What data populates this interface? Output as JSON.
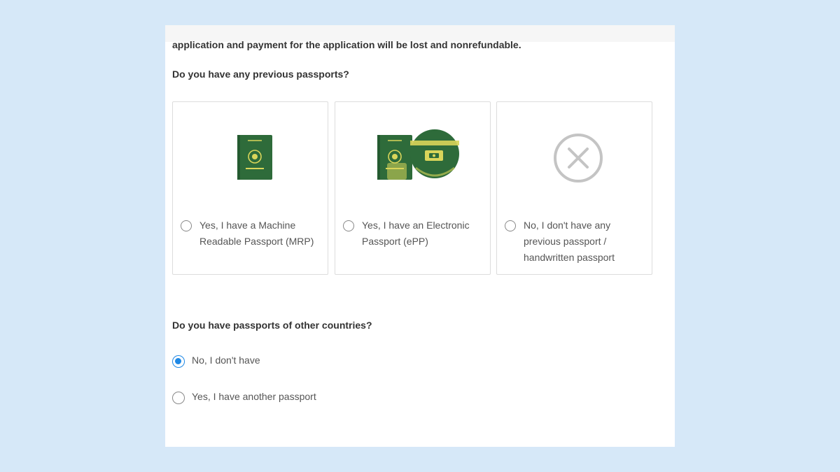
{
  "intro": {
    "text": "application and payment for the application will be lost and nonrefundable."
  },
  "previous_passports": {
    "question": "Do you have any previous passports?",
    "options": [
      {
        "label": "Yes, I have a Machine Readable Passport (MRP)",
        "icon": "mrp-passport-icon",
        "selected": false
      },
      {
        "label": "Yes, I have an Electronic Passport (ePP)",
        "icon": "epassport-chip-icon",
        "selected": false
      },
      {
        "label": "No, I don't have any previous passport / handwritten passport",
        "icon": "no-passport-x-icon",
        "selected": false
      }
    ]
  },
  "other_countries": {
    "question": "Do you have passports of other countries?",
    "options": [
      {
        "label": "No, I don't have",
        "selected": true
      },
      {
        "label": "Yes, I have another passport",
        "selected": false
      }
    ]
  },
  "colors": {
    "background": "#d6e8f8",
    "passport_green": "#2e6b3a",
    "passport_gold": "#d9d55a",
    "radio_selected": "#1e88e5",
    "x_icon_gray": "#c4c4c4"
  }
}
